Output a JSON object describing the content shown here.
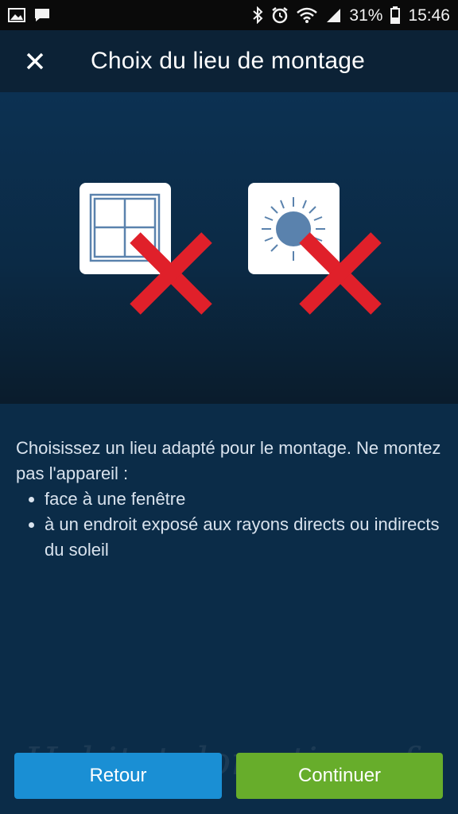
{
  "status_bar": {
    "battery": "31%",
    "time": "15:46"
  },
  "header": {
    "title": "Choix du lieu de montage",
    "close_icon": "close-icon"
  },
  "illustration": {
    "items": [
      {
        "icon": "window-icon",
        "crossed": true
      },
      {
        "icon": "sun-icon",
        "crossed": true
      }
    ],
    "colors": {
      "cross": "#e0202a",
      "card": "#ffffff",
      "glyph": "#5a82ad"
    }
  },
  "content": {
    "intro": "Choisissez un lieu adapté pour le montage. Ne montez pas l'appareil :",
    "bullets": [
      "face à une fenêtre",
      "à un endroit exposé aux rayons directs ou indirects du soleil"
    ]
  },
  "watermark": "Habitat-domotique.fr",
  "buttons": {
    "back": "Retour",
    "continue": "Continuer"
  },
  "colors": {
    "background": "#0b2c48",
    "header": "#0c2236",
    "back_button": "#1a8fd4",
    "continue_button": "#67ad2b"
  }
}
